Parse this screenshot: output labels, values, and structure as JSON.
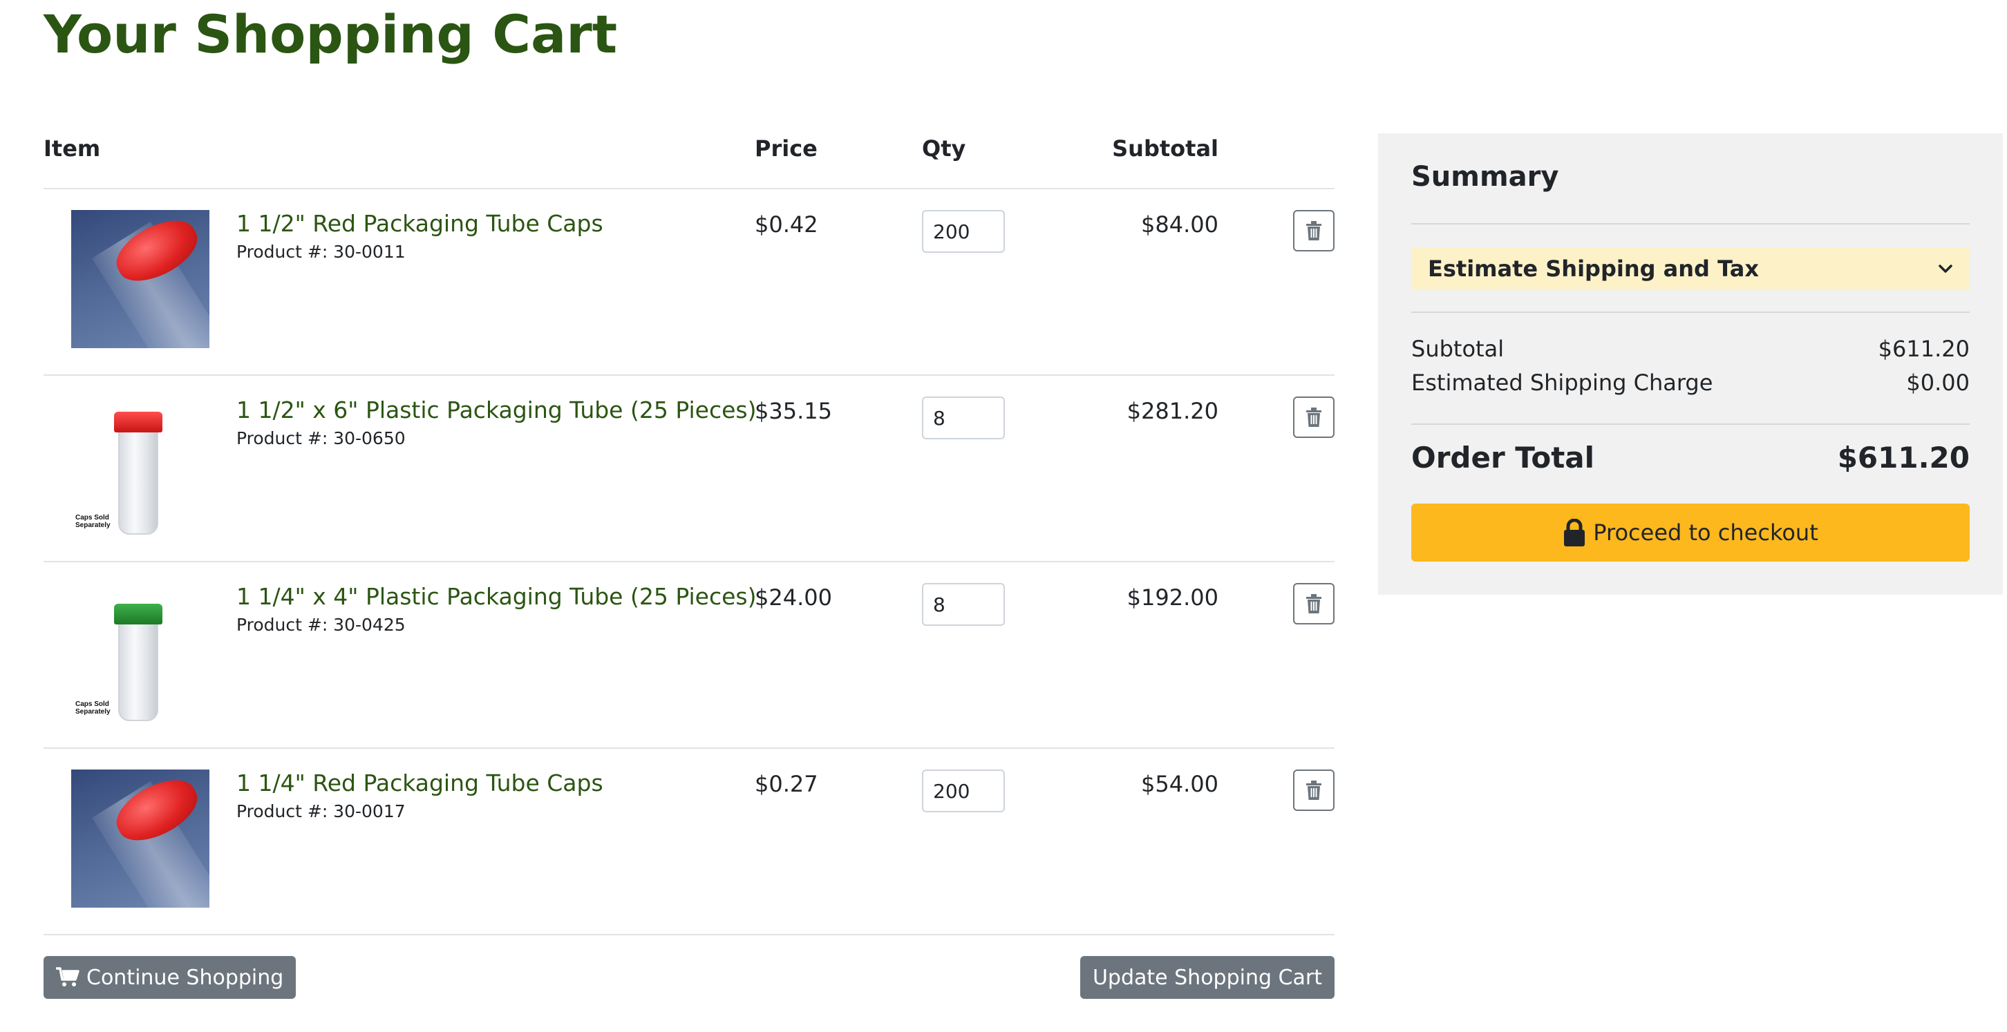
{
  "page": {
    "title": "Your Shopping Cart"
  },
  "cart": {
    "headers": {
      "item": "Item",
      "price": "Price",
      "qty": "Qty",
      "subtotal": "Subtotal"
    },
    "items": [
      {
        "name": "1 1/2\" Red Packaging Tube Caps",
        "product_number": "Product #: 30-0011",
        "price": "$0.42",
        "qty": "200",
        "subtotal": "$84.00",
        "thumb_caption": ""
      },
      {
        "name": "1 1/2\" x 6\" Plastic Packaging Tube (25 Pieces)",
        "product_number": "Product #: 30-0650",
        "price": "$35.15",
        "qty": "8",
        "subtotal": "$281.20",
        "thumb_caption": "Caps Sold Separately"
      },
      {
        "name": "1 1/4\" x 4\" Plastic Packaging Tube (25 Pieces)",
        "product_number": "Product #: 30-0425",
        "price": "$24.00",
        "qty": "8",
        "subtotal": "$192.00",
        "thumb_caption": "Caps Sold Separately"
      },
      {
        "name": "1 1/4\" Red Packaging Tube Caps",
        "product_number": "Product #: 30-0017",
        "price": "$0.27",
        "qty": "200",
        "subtotal": "$54.00",
        "thumb_caption": ""
      }
    ],
    "actions": {
      "continue_label": "Continue Shopping",
      "update_label": "Update Shopping Cart"
    }
  },
  "summary": {
    "title": "Summary",
    "estimate_label": "Estimate Shipping and Tax",
    "subtotal_label": "Subtotal",
    "subtotal_value": "$611.20",
    "shipping_label": "Estimated Shipping Charge",
    "shipping_value": "$0.00",
    "total_label": "Order Total",
    "total_value": "$611.20",
    "checkout_label": "Proceed to checkout"
  },
  "colors": {
    "title_green": "#2b5512",
    "checkout_yellow": "#fdb81e",
    "estimate_bg": "#fdf1c8",
    "button_gray": "#6c757d"
  }
}
